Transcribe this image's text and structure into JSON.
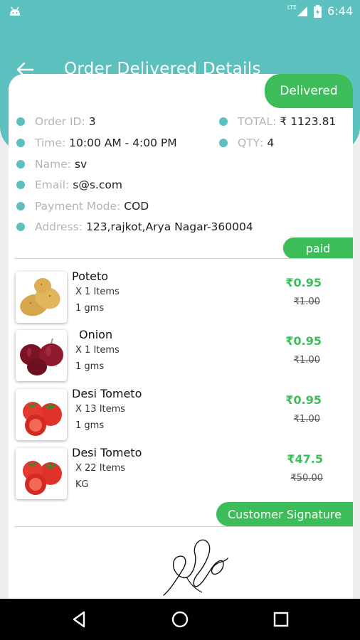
{
  "status_bar": {
    "time": "6:44",
    "network": "LTE"
  },
  "header": {
    "title": "Order Delivered Details"
  },
  "order": {
    "status_badge": "Delivered",
    "order_id": {
      "label": "Order ID",
      "value": "3"
    },
    "total": {
      "label": "TOTAL",
      "value": "₹ 1123.81"
    },
    "time": {
      "label": "Time",
      "value": "10:00 AM - 4:00 PM"
    },
    "qty": {
      "label": "QTY",
      "value": "4"
    },
    "name": {
      "label": "Name",
      "value": "sv"
    },
    "email": {
      "label": "Email",
      "value": "s@s.com"
    },
    "payment_mode": {
      "label": "Payment Mode",
      "value": "COD"
    },
    "address": {
      "label": "Address",
      "value": "123,rajkot,Arya Nagar-360004"
    },
    "payment_badge": "paid"
  },
  "items": [
    {
      "name": "Poteto",
      "qty": "X 1 Items",
      "unit": "1 gms",
      "price": "₹0.95",
      "mrp": "₹1.00",
      "icon": "potato-image"
    },
    {
      "name": "Onion",
      "qty": "X 1 Items",
      "unit": "1 gms",
      "price": "₹0.95",
      "mrp": "₹1.00",
      "icon": "onion-image"
    },
    {
      "name": "Desi Tometo",
      "qty": "X 13 Items",
      "unit": "1 gms",
      "price": "₹0.95",
      "mrp": "₹1.00",
      "icon": "tomato-image"
    },
    {
      "name": "Desi Tometo",
      "qty": "X 22 Items",
      "unit": "KG",
      "price": "₹47.5",
      "mrp": "₹50.00",
      "icon": "tomato-image"
    }
  ],
  "signature": {
    "label": "Customer Signature"
  },
  "colors": {
    "primary": "#5bc0be",
    "accent_green": "#3dbd5a"
  }
}
